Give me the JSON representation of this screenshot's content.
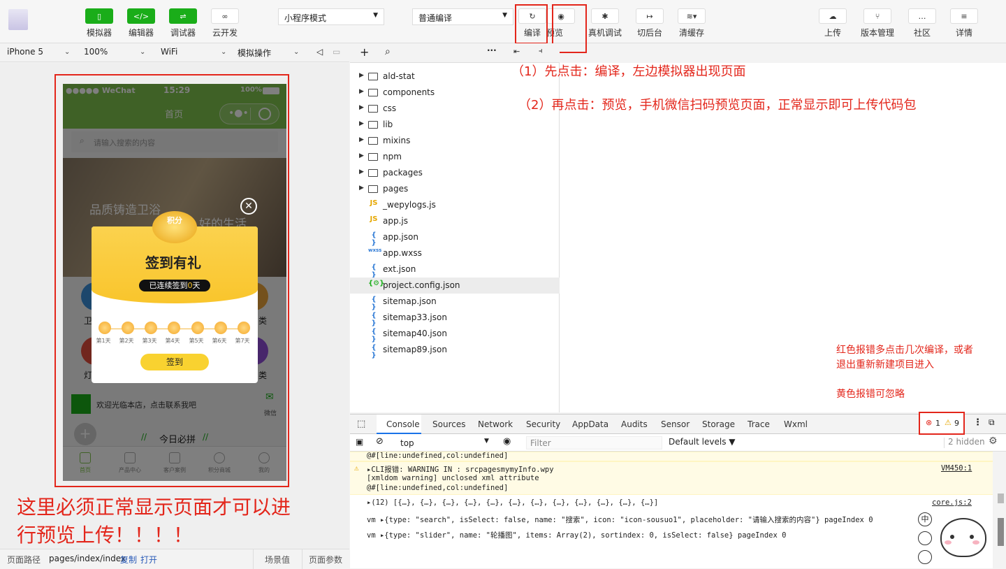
{
  "toolbar": {
    "simulator": "模拟器",
    "editor": "编辑器",
    "debugger": "调试器",
    "cloud": "云开发",
    "mode_select": "小程序模式",
    "compile_select": "普通编译",
    "compile": "编译",
    "preview": "预览",
    "remote_debug": "真机调试",
    "background": "切后台",
    "clear_cache": "清缓存",
    "upload": "上传",
    "version": "版本管理",
    "community": "社区",
    "details": "详情"
  },
  "subbar": {
    "device": "iPhone 5",
    "zoom": "100%",
    "network": "WiFi",
    "operation": "模拟操作"
  },
  "phone": {
    "signal": "●●●●● WeChat",
    "time": "15:29",
    "battery": "100%",
    "title": "首页",
    "search_placeholder": "请输入搜索的内容",
    "banner_text": "品质铸造卫浴",
    "banner_text2": "好的生活",
    "popup_coin_label": "积分",
    "popup_title": "签到有礼",
    "popup_streak_prefix": "已连续签到",
    "popup_streak_num": "0",
    "popup_streak_suffix": "天",
    "days": [
      "第1天",
      "第2天",
      "第3天",
      "第4天",
      "第5天",
      "第6天",
      "第7天"
    ],
    "sign_button": "签到",
    "welcome": "欢迎光临本店，点击联系我吧",
    "wechat": "微信",
    "today_group": "今日必拼",
    "tabs": [
      "首页",
      "产品中心",
      "客户案例",
      "积分商城",
      "我的"
    ],
    "partial_left1": "卫",
    "partial_right1": "类",
    "partial_left2": "灯",
    "partial_right2": "类"
  },
  "annotations": {
    "step1": "（1）先点击：编译，左边模拟器出现页面",
    "step2": "（2）再点击：预览，手机微信扫码预览页面，正常显示即可上传代码包",
    "must_show_line1": "这里必须正常显示页面才可以进",
    "must_show_line2": "行预览上传！！！！",
    "red_error_line1": "红色报错多点击几次编译，或者",
    "red_error_line2": "退出重新新建项目进入",
    "yellow_ignore": "黄色报错可忽略"
  },
  "bottombar": {
    "path_label": "页面路径",
    "path": "pages/index/index",
    "copy": "复制",
    "open": "打开",
    "scene": "场景值",
    "params": "页面参数"
  },
  "filetree": [
    {
      "name": "ald-stat",
      "type": "folder"
    },
    {
      "name": "components",
      "type": "folder"
    },
    {
      "name": "css",
      "type": "folder"
    },
    {
      "name": "lib",
      "type": "folder"
    },
    {
      "name": "mixins",
      "type": "folder"
    },
    {
      "name": "npm",
      "type": "folder"
    },
    {
      "name": "packages",
      "type": "folder"
    },
    {
      "name": "pages",
      "type": "folder"
    },
    {
      "name": "_wepylogs.js",
      "type": "js"
    },
    {
      "name": "app.js",
      "type": "js"
    },
    {
      "name": "app.json",
      "type": "json"
    },
    {
      "name": "app.wxss",
      "type": "wxss"
    },
    {
      "name": "ext.json",
      "type": "json"
    },
    {
      "name": "project.config.json",
      "type": "config"
    },
    {
      "name": "sitemap.json",
      "type": "json"
    },
    {
      "name": "sitemap33.json",
      "type": "json"
    },
    {
      "name": "sitemap40.json",
      "type": "json"
    },
    {
      "name": "sitemap89.json",
      "type": "json"
    }
  ],
  "devtools": {
    "tabs": [
      "Console",
      "Sources",
      "Network",
      "Security",
      "AppData",
      "Audits",
      "Sensor",
      "Storage",
      "Trace",
      "Wxml"
    ],
    "errors": "1",
    "warnings": "9",
    "context": "top",
    "filter_placeholder": "Filter",
    "levels": "Default levels",
    "hidden": "2 hidden"
  },
  "console": {
    "line0": "@#[line:undefined,col:undefined]",
    "warn1": "▸CLI报错: WARNING IN : srcpagesmymyInfo.wpy",
    "warn1_src": "VM450:1",
    "warn2": "[xmldom warning]    unclosed xml attribute",
    "warn3": "@#[line:undefined,col:undefined]",
    "arr": "▸(12) [{…}, {…}, {…}, {…}, {…}, {…}, {…}, {…}, {…}, {…}, {…}, {…}]",
    "arr_src": "core.js:2",
    "vm1": "vm ▸{type: \"search\", isSelect: false, name: \"搜索\", icon: \"icon-sousuo1\", placeholder: \"请输入搜索的内容\"} pageIndex 0",
    "vm2": "vm ▸{type: \"slider\", name: \"轮播图\", items: Array(2), sortindex: 0, isSelect: false} pageIndex 0"
  }
}
